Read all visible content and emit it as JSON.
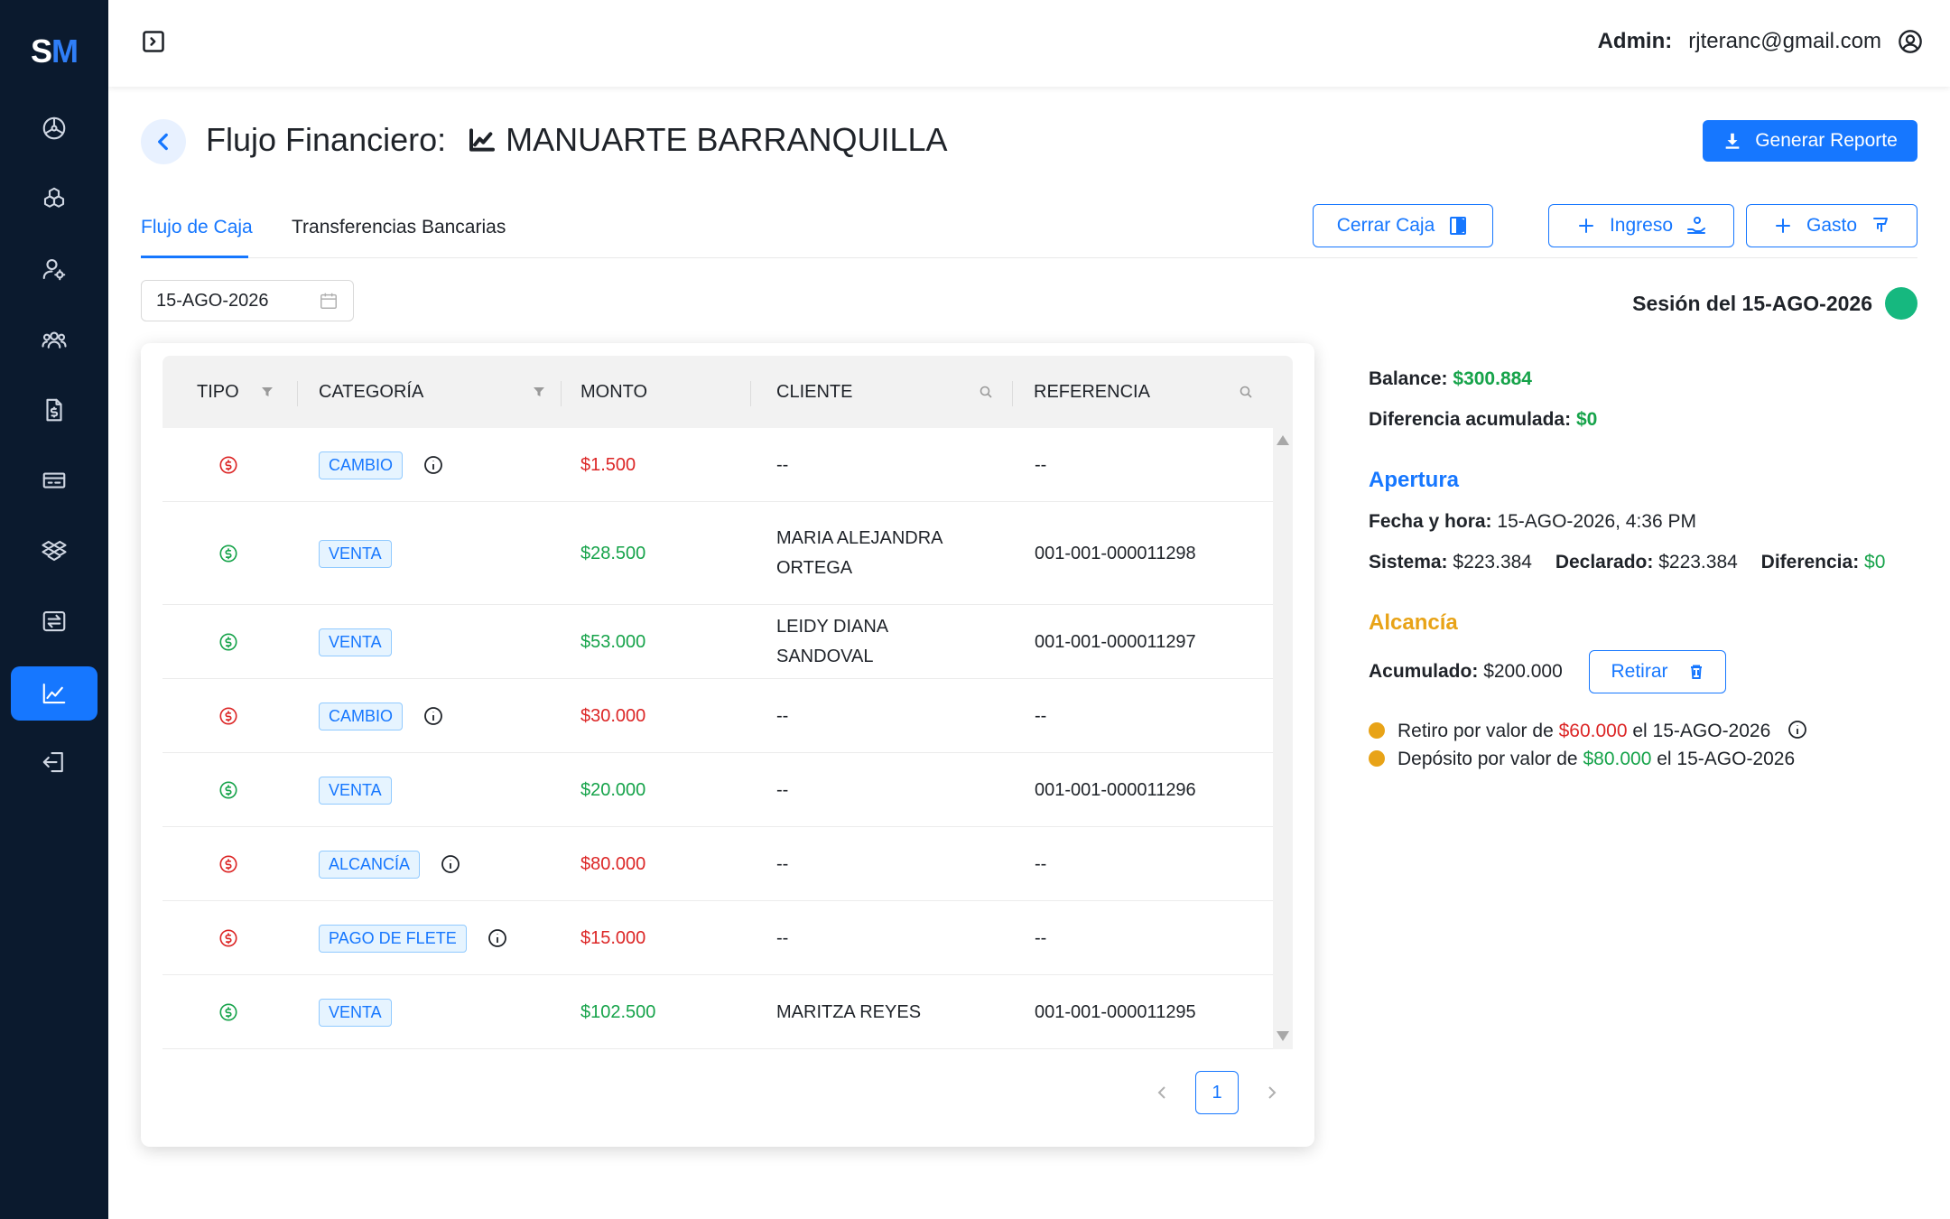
{
  "logo": {
    "s": "S",
    "m": "M"
  },
  "header": {
    "admin_label": "Admin:",
    "admin_email": "rjteranc@gmail.com"
  },
  "page": {
    "title_prefix": "Flujo Financiero:",
    "store_name": "MANUARTE BARRANQUILLA",
    "report_button": "Generar Reporte"
  },
  "tabs": [
    {
      "label": "Flujo de Caja",
      "active": true
    },
    {
      "label": "Transferencias Bancarias",
      "active": false
    }
  ],
  "actions": {
    "close_cash": "Cerrar Caja",
    "income": "Ingreso",
    "expense": "Gasto"
  },
  "date_filter": {
    "value": "15-AGO-2026"
  },
  "session": {
    "label": "Sesión del 15-AGO-2026",
    "status_color": "#16b87f"
  },
  "table": {
    "headers": {
      "tipo": "TIPO",
      "categoria": "CATEGORÍA",
      "monto": "MONTO",
      "cliente": "CLIENTE",
      "referencia": "REFERENCIA"
    },
    "rows": [
      {
        "type": "expense",
        "category": "CAMBIO",
        "info": true,
        "amount": "$1.500",
        "client": "--",
        "reference": "--"
      },
      {
        "type": "income",
        "category": "VENTA",
        "info": false,
        "amount": "$28.500",
        "client": "MARIA ALEJANDRA ORTEGA",
        "reference": "001-001-000011298"
      },
      {
        "type": "income",
        "category": "VENTA",
        "info": false,
        "amount": "$53.000",
        "client": "LEIDY DIANA SANDOVAL",
        "reference": "001-001-000011297"
      },
      {
        "type": "expense",
        "category": "CAMBIO",
        "info": true,
        "amount": "$30.000",
        "client": "--",
        "reference": "--"
      },
      {
        "type": "income",
        "category": "VENTA",
        "info": false,
        "amount": "$20.000",
        "client": "--",
        "reference": "001-001-000011296"
      },
      {
        "type": "expense",
        "category": "ALCANCÍA",
        "info": true,
        "amount": "$80.000",
        "client": "--",
        "reference": "--"
      },
      {
        "type": "expense",
        "category": "PAGO DE FLETE",
        "info": true,
        "amount": "$15.000",
        "client": "--",
        "reference": "--"
      },
      {
        "type": "income",
        "category": "VENTA",
        "info": false,
        "amount": "$102.500",
        "client": "MARITZA REYES",
        "reference": "001-001-000011295"
      }
    ],
    "pagination": {
      "current_page": "1"
    }
  },
  "summary": {
    "balance_label": "Balance:",
    "balance_value": "$300.884",
    "diff_label": "Diferencia acumulada:",
    "diff_value": "$0",
    "apertura_title": "Apertura",
    "fecha_label": "Fecha y hora:",
    "fecha_value": "15-AGO-2026, 4:36 PM",
    "sistema_label": "Sistema:",
    "sistema_value": "$223.384",
    "declarado_label": "Declarado:",
    "declarado_value": "$223.384",
    "diferencia_label": "Diferencia:",
    "diferencia_value": "$0",
    "alcancia_title": "Alcancía",
    "acumulado_label": "Acumulado:",
    "acumulado_value": "$200.000",
    "retirar_button": "Retirar",
    "movements": [
      {
        "prefix": "Retiro por valor de",
        "amount": "$60.000",
        "suffix": "el 15-AGO-2026",
        "kind": "withdrawal"
      },
      {
        "prefix": "Depósito por valor de",
        "amount": "$80.000",
        "suffix": "el 15-AGO-2026",
        "kind": "deposit"
      }
    ]
  },
  "colors": {
    "primary": "#1677ff",
    "sidebar": "#0b1a2e",
    "income": "#16a34a",
    "expense": "#dc2626",
    "piggy": "#e8a317"
  }
}
